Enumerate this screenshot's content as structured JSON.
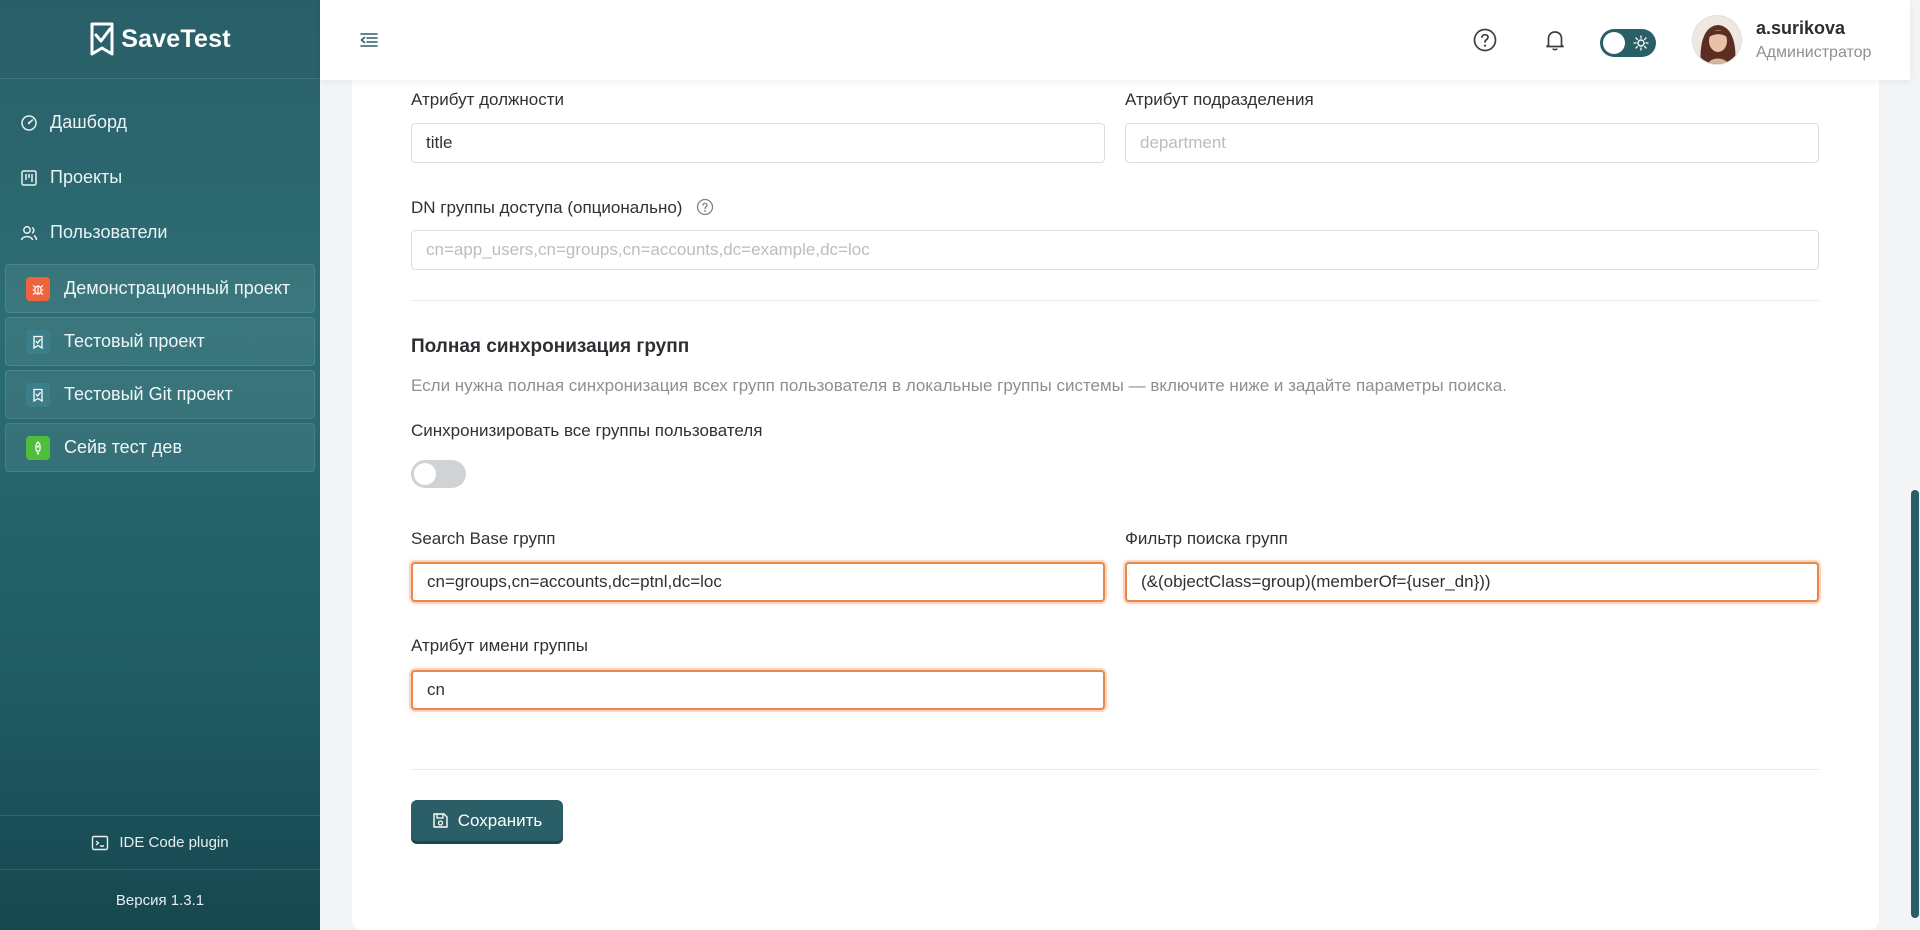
{
  "app": {
    "name": "SaveTest"
  },
  "sidebar": {
    "nav": [
      {
        "label": "Дашборд",
        "icon": "dashboard-icon"
      },
      {
        "label": "Проекты",
        "icon": "projects-icon"
      },
      {
        "label": "Пользователи",
        "icon": "users-icon"
      }
    ],
    "projects": [
      {
        "label": "Демонстрационный проект",
        "icon": "bug-icon",
        "color": "#f0643c"
      },
      {
        "label": "Тестовый проект",
        "icon": "savetest-icon",
        "color": "#3d7f89"
      },
      {
        "label": "Тестовый Git проект",
        "icon": "savetest-icon",
        "color": "#3d7f89"
      },
      {
        "label": "Сейв тест дев",
        "icon": "rocket-icon",
        "color": "#4fbe3c"
      }
    ],
    "plugin_label": "IDE Code plugin",
    "version": "Версия 1.3.1"
  },
  "header": {
    "user_name": "a.surikova",
    "user_role": "Администратор"
  },
  "form": {
    "position_attr": {
      "label": "Атрибут должности",
      "value": "title"
    },
    "department_attr": {
      "label": "Атрибут подразделения",
      "placeholder": "department"
    },
    "access_group_dn": {
      "label": "DN группы доступа (опционально)",
      "placeholder": "cn=app_users,cn=groups,cn=accounts,dc=example,dc=loc"
    },
    "group_sync": {
      "title": "Полная синхронизация групп",
      "description": "Если нужна полная синхронизация всех групп пользователя в локальные группы системы — включите ниже и задайте параметры поиска.",
      "toggle_label": "Синхронизировать все группы пользователя",
      "toggle_on": false
    },
    "search_base": {
      "label": "Search Base групп",
      "value": "cn=groups,cn=accounts,dc=ptnl,dc=loc"
    },
    "search_filter": {
      "label": "Фильтр поиска групп",
      "value": "(&(objectClass=group)(memberOf={user_dn}))"
    },
    "group_name_attr": {
      "label": "Атрибут имени группы",
      "value": "cn"
    },
    "save_label": "Сохранить"
  },
  "colors": {
    "accent": "#2b5f68",
    "highlight": "#e8884a"
  }
}
